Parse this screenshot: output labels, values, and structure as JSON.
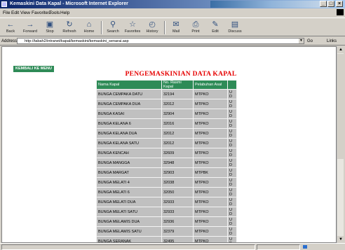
{
  "window": {
    "title": "Kemaskini Data Kapal - Microsoft Internet Explorer",
    "minimize": "_",
    "maximize": "□",
    "close": "×"
  },
  "menu": [
    "File",
    "Edit",
    "View",
    "Favorites",
    "Tools",
    "Help"
  ],
  "toolbar": {
    "buttons": [
      {
        "label": "Back",
        "icon": "back-arrow-icon"
      },
      {
        "label": "Forward",
        "icon": "forward-arrow-icon"
      },
      {
        "label": "Stop",
        "icon": "stop-icon"
      },
      {
        "label": "Refresh",
        "icon": "refresh-icon"
      },
      {
        "label": "Home",
        "icon": "home-icon"
      },
      {
        "label": "Search",
        "icon": "search-icon"
      },
      {
        "label": "Favorites",
        "icon": "favorites-icon"
      },
      {
        "label": "History",
        "icon": "history-icon"
      },
      {
        "label": "Mail",
        "icon": "mail-icon"
      },
      {
        "label": "Print",
        "icon": "print-icon"
      },
      {
        "label": "Edit",
        "icon": "edit-icon"
      },
      {
        "label": "Discuss",
        "icon": "discuss-icon"
      }
    ]
  },
  "address": {
    "label": "Address",
    "url": "http://tabah2/intranet/kapal/kemaskini/kemaskini_senarai.asp",
    "go": "Go",
    "links": "Links"
  },
  "page": {
    "back_link": "KEMBALI KE MENU",
    "title": "PENGEMASKINIAN DATA KAPAL",
    "columns": [
      "Nama Kapal",
      "No. Rasmi Kapal",
      "Pelabuhan Asal",
      ""
    ],
    "rows": [
      {
        "name": "BUNGA CEMPAKA DATU",
        "no": "32194",
        "port": "MTPKO",
        "action": "U D"
      },
      {
        "name": "BUNGA CEMPAKA DUA",
        "no": "32012",
        "port": "MTPKO",
        "action": "U D"
      },
      {
        "name": "BUNGA KASAI",
        "no": "32904",
        "port": "MTPKO",
        "action": "U D"
      },
      {
        "name": "BUNGA KELANA 6",
        "no": "32016",
        "port": "MTPKO",
        "action": "U D"
      },
      {
        "name": "BUNGA KELANA DUA",
        "no": "32012",
        "port": "MTPKO",
        "action": "U D"
      },
      {
        "name": "BUNGA KELANA SATU",
        "no": "32012",
        "port": "MTPKO",
        "action": "U D"
      },
      {
        "name": "BUNGA KENCAH",
        "no": "32609",
        "port": "MTPKO",
        "action": "U D"
      },
      {
        "name": "BUNGA MANGGA",
        "no": "32948",
        "port": "MTPKO",
        "action": "U D"
      },
      {
        "name": "BUNGA MARGAT",
        "no": "32903",
        "port": "MTPBK",
        "action": "U D"
      },
      {
        "name": "BUNGA MELATI 4",
        "no": "32038",
        "port": "MTPKO",
        "action": "U D"
      },
      {
        "name": "BUNGA MELATI 6",
        "no": "32050",
        "port": "MTPKO",
        "action": "U D"
      },
      {
        "name": "BUNGA MELATI DUA",
        "no": "32933",
        "port": "MTPKO",
        "action": "U D"
      },
      {
        "name": "BUNGA MELATI SATU",
        "no": "32933",
        "port": "MTPKO",
        "action": "U D"
      },
      {
        "name": "BUNGA MELAWIS DUA",
        "no": "32936",
        "port": "MTPKO",
        "action": "U D"
      },
      {
        "name": "BUNGA MELAWIS SATU",
        "no": "32379",
        "port": "MTPKO",
        "action": "U D"
      },
      {
        "name": "BUNGA SERANAK",
        "no": "32495",
        "port": "MTPKO",
        "action": "U D"
      }
    ]
  },
  "colors": {
    "title_red": "#e60000",
    "header_green": "#2e8b57",
    "row_grey": "#c0c0c0"
  }
}
